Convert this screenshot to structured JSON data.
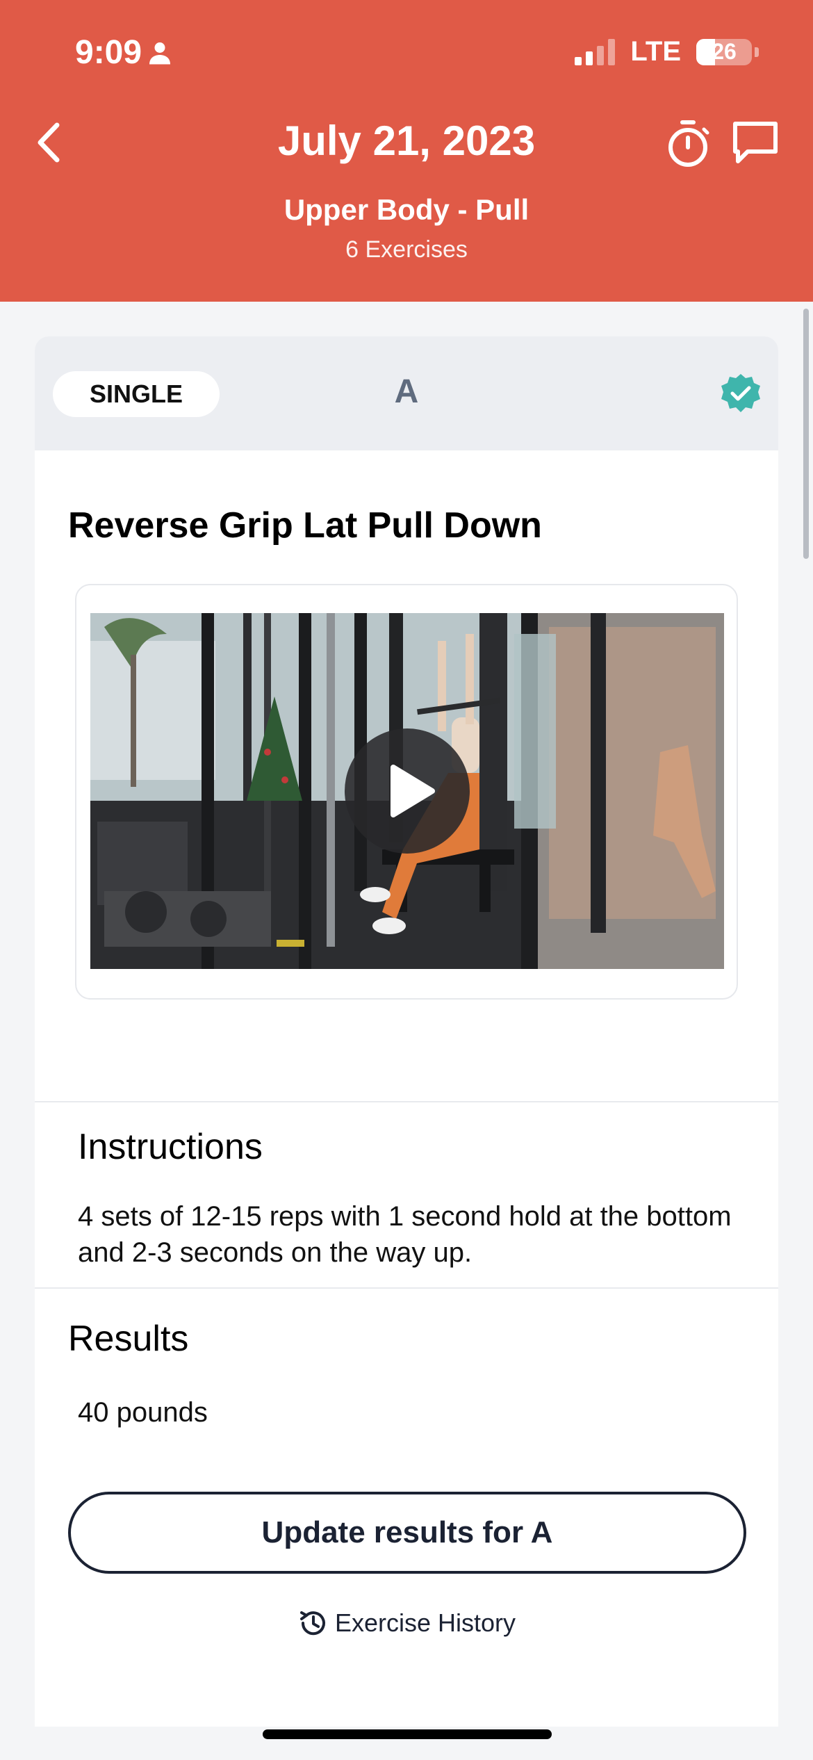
{
  "status_bar": {
    "time": "9:09",
    "network": "LTE",
    "battery": "26"
  },
  "header": {
    "date_title": "July 21, 2023",
    "workout_name": "Upper Body - Pull",
    "exercise_count": "6 Exercises",
    "accent_color": "#e05a47"
  },
  "exercise": {
    "type_pill": "SINGLE",
    "letter": "A",
    "completed": true,
    "title": "Reverse Grip Lat Pull Down"
  },
  "instructions": {
    "heading": "Instructions",
    "text": "4 sets of 12-15 reps with 1 second hold at the bottom and 2-3 seconds on the way up."
  },
  "results": {
    "heading": "Results",
    "value": "40 pounds",
    "update_button": "Update results for A",
    "history_link": "Exercise History"
  }
}
